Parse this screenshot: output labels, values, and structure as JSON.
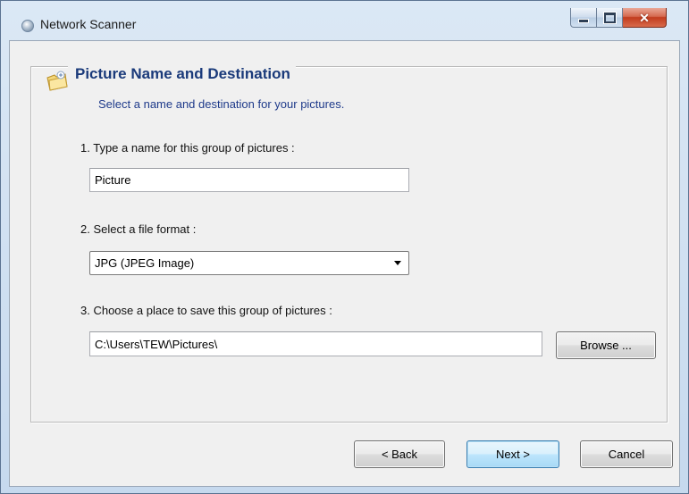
{
  "window": {
    "title": "Network Scanner"
  },
  "header": {
    "title": "Picture Name and Destination",
    "subtitle": "Select a name and destination for your pictures."
  },
  "steps": {
    "name_label": "1. Type a name for this group of pictures :",
    "name_value": "Picture",
    "format_label": "2. Select a file format :",
    "format_value": "JPG (JPEG Image)",
    "folder_label": "3. Choose a place to save this group of pictures :",
    "folder_value": "C:\\Users\\TEW\\Pictures\\",
    "browse_label": "Browse ..."
  },
  "footer": {
    "back_label": "< Back",
    "next_label": "Next >",
    "cancel_label": "Cancel"
  },
  "icons": {
    "app": "scanner-icon",
    "header": "pictures-folder-icon"
  }
}
